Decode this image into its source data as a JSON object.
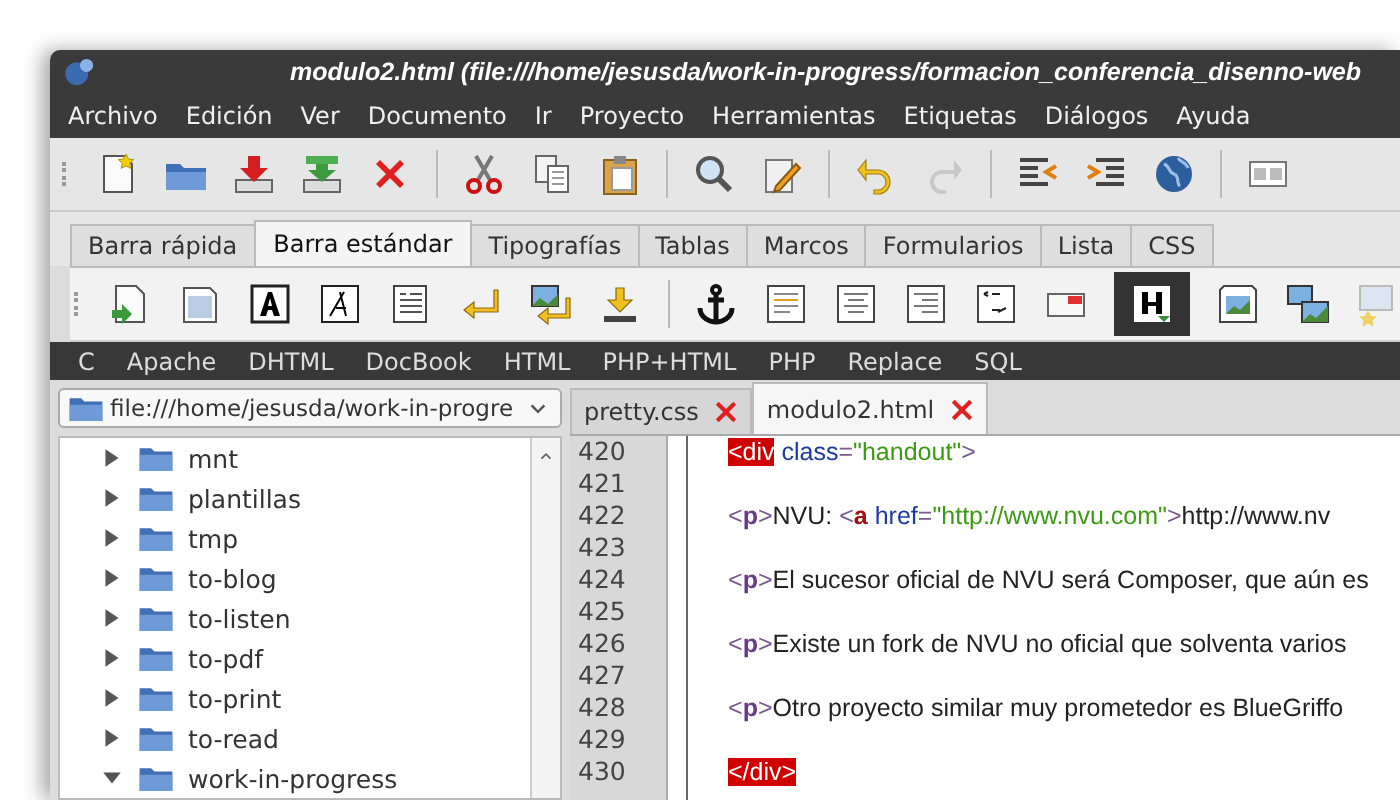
{
  "window": {
    "title": "modulo2.html (file:///home/jesusda/work-in-progress/formacion_conferencia_disenno-web"
  },
  "menu": [
    "Archivo",
    "Edición",
    "Ver",
    "Documento",
    "Ir",
    "Proyecto",
    "Herramientas",
    "Etiquetas",
    "Diálogos",
    "Ayuda"
  ],
  "toolbar_tabs": [
    {
      "label": "Barra rápida",
      "selected": false
    },
    {
      "label": "Barra estándar",
      "selected": true
    },
    {
      "label": "Tipografías",
      "selected": false
    },
    {
      "label": "Tablas",
      "selected": false
    },
    {
      "label": "Marcos",
      "selected": false
    },
    {
      "label": "Formularios",
      "selected": false
    },
    {
      "label": "Lista",
      "selected": false
    },
    {
      "label": "CSS",
      "selected": false
    }
  ],
  "custom_menu": [
    "C",
    "Apache",
    "DHTML",
    "DocBook",
    "HTML",
    "PHP+HTML",
    "PHP",
    "Replace",
    "SQL"
  ],
  "file_browser": {
    "location": "file:///home/jesusda/work-in-progre",
    "items": [
      {
        "name": "mnt",
        "expanded": false
      },
      {
        "name": "plantillas",
        "expanded": false
      },
      {
        "name": "tmp",
        "expanded": false
      },
      {
        "name": "to-blog",
        "expanded": false
      },
      {
        "name": "to-listen",
        "expanded": false
      },
      {
        "name": "to-pdf",
        "expanded": false
      },
      {
        "name": "to-print",
        "expanded": false
      },
      {
        "name": "to-read",
        "expanded": false
      },
      {
        "name": "work-in-progress",
        "expanded": true
      }
    ]
  },
  "editor_tabs": [
    {
      "label": "pretty.css",
      "selected": false
    },
    {
      "label": "modulo2.html",
      "selected": true
    }
  ],
  "code_lines": [
    {
      "number": "420",
      "segments": [
        {
          "kind": "div",
          "text": "<div"
        },
        {
          "kind": "attr",
          "text": " class"
        },
        {
          "kind": "punct",
          "text": "="
        },
        {
          "kind": "str",
          "text": "\"handout\""
        },
        {
          "kind": "punct",
          "text": ">"
        }
      ]
    },
    {
      "number": "421"
    },
    {
      "number": "422",
      "segments": [
        {
          "kind": "punct",
          "text": "<"
        },
        {
          "kind": "p",
          "text": "p"
        },
        {
          "kind": "punct",
          "text": ">"
        },
        {
          "kind": "text",
          "text": "NVU: "
        },
        {
          "kind": "punct",
          "text": "<"
        },
        {
          "kind": "a",
          "text": "a"
        },
        {
          "kind": "attr",
          "text": " href"
        },
        {
          "kind": "punct",
          "text": "="
        },
        {
          "kind": "str",
          "text": "\"http://www.nvu.com\""
        },
        {
          "kind": "punct",
          "text": ">"
        },
        {
          "kind": "text",
          "text": "http://www.nv"
        }
      ]
    },
    {
      "number": "423"
    },
    {
      "number": "424",
      "segments": [
        {
          "kind": "punct",
          "text": "<"
        },
        {
          "kind": "p",
          "text": "p"
        },
        {
          "kind": "punct",
          "text": ">"
        },
        {
          "kind": "text",
          "text": "El sucesor oficial de NVU será Composer, que aún es"
        }
      ]
    },
    {
      "number": "425"
    },
    {
      "number": "426",
      "segments": [
        {
          "kind": "punct",
          "text": "<"
        },
        {
          "kind": "p",
          "text": "p"
        },
        {
          "kind": "punct",
          "text": ">"
        },
        {
          "kind": "text",
          "text": "Existe un fork de NVU no oficial que solventa varios"
        }
      ]
    },
    {
      "number": "427"
    },
    {
      "number": "428",
      "segments": [
        {
          "kind": "punct",
          "text": "<"
        },
        {
          "kind": "p",
          "text": "p"
        },
        {
          "kind": "punct",
          "text": ">"
        },
        {
          "kind": "text",
          "text": "Otro proyecto similar muy prometedor es BlueGriffo"
        }
      ]
    },
    {
      "number": "429"
    },
    {
      "number": "430",
      "segments": [
        {
          "kind": "div",
          "text": "</div>"
        }
      ]
    }
  ]
}
